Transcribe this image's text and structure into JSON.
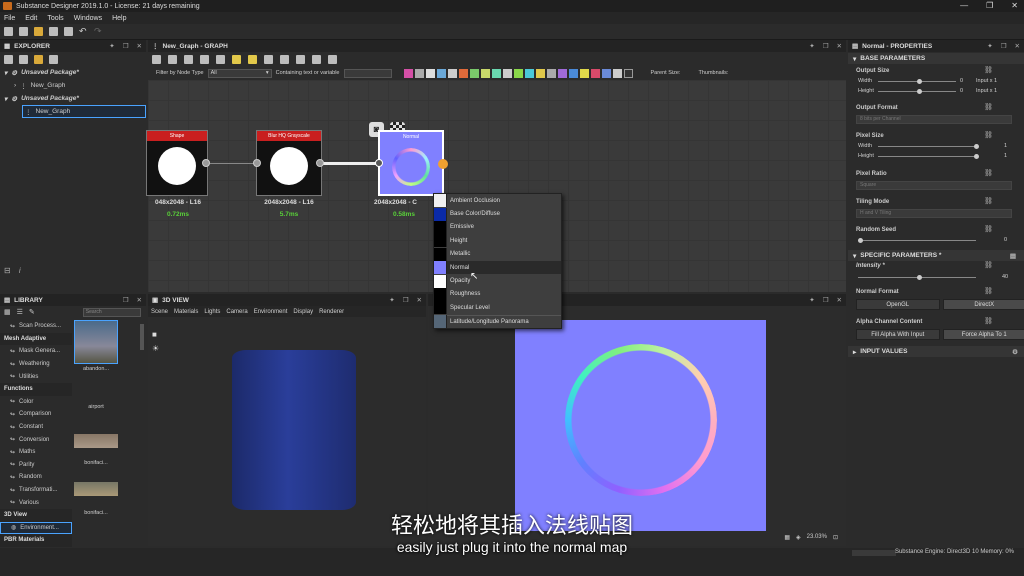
{
  "window": {
    "title": "Substance Designer 2019.1.0 - License: 21 days remaining",
    "minimize": "—",
    "maximize": "❐",
    "close": "✕"
  },
  "menu": [
    "File",
    "Edit",
    "Tools",
    "Windows",
    "Help"
  ],
  "explorer": {
    "title": "EXPLORER",
    "items": [
      {
        "label": "Unsaved Package*",
        "type": "package"
      },
      {
        "label": "New_Graph",
        "type": "graph"
      },
      {
        "label": "Unsaved Package*",
        "type": "package"
      },
      {
        "label": "New_Graph",
        "type": "graph",
        "selected": true
      }
    ]
  },
  "graph": {
    "title": "New_Graph - GRAPH",
    "filter_label": "Filter by Node Type",
    "filter_value": "All",
    "containing_label": "Containing text or variable",
    "parent_size_label": "Parent Size:",
    "thumbnails_label": "Thumbnails:",
    "nodes": [
      {
        "header": "Shape",
        "resolution": "048x2048 - L16",
        "time": "0.72ms"
      },
      {
        "header": "Blur HQ Grayscale",
        "resolution": "2048x2048 - L16",
        "time": "5.7ms"
      },
      {
        "header": "Normal",
        "resolution": "2048x2048 - C",
        "time": "0.58ms"
      }
    ],
    "dropdown": [
      {
        "label": "Ambient Occlusion",
        "color": "#f0f0f0"
      },
      {
        "label": "Base Color/Diffuse",
        "color": "#0a2aa8"
      },
      {
        "label": "Emissive",
        "color": "#000000"
      },
      {
        "label": "Height",
        "color": "#000000"
      },
      {
        "label": "Metallic",
        "color": "#000000"
      },
      {
        "label": "Normal",
        "color": "#8080ff",
        "hovered": true
      },
      {
        "label": "Opacity",
        "color": "#ffffff"
      },
      {
        "label": "Roughness",
        "color": "#000000"
      },
      {
        "label": "Specular Level",
        "color": "#000000"
      },
      {
        "label": "Latitude/Longitude Panorama",
        "color": "#556677"
      }
    ]
  },
  "library": {
    "title": "LIBRARY",
    "search_placeholder": "Search",
    "items": [
      {
        "label": "Scan Process...",
        "kind": "item"
      },
      {
        "label": "Mesh Adaptive",
        "kind": "cat"
      },
      {
        "label": "Mask Genera...",
        "kind": "item"
      },
      {
        "label": "Weathering",
        "kind": "item"
      },
      {
        "label": "Utilities",
        "kind": "item"
      },
      {
        "label": "Functions",
        "kind": "cat"
      },
      {
        "label": "Color",
        "kind": "item"
      },
      {
        "label": "Comparison",
        "kind": "item"
      },
      {
        "label": "Constant",
        "kind": "item"
      },
      {
        "label": "Conversion",
        "kind": "item"
      },
      {
        "label": "Maths",
        "kind": "item"
      },
      {
        "label": "Parity",
        "kind": "item"
      },
      {
        "label": "Random",
        "kind": "item"
      },
      {
        "label": "Transformati...",
        "kind": "item"
      },
      {
        "label": "Various",
        "kind": "item"
      },
      {
        "label": "3D View",
        "kind": "cat"
      },
      {
        "label": "Environment...",
        "kind": "selected"
      },
      {
        "label": "PBR Materials",
        "kind": "cat"
      }
    ],
    "thumbs": [
      "abandon...",
      "airport",
      "bonifaci...",
      "bonifaci..."
    ]
  },
  "view3d": {
    "title": "3D VIEW",
    "menu": [
      "Scene",
      "Materials",
      "Lights",
      "Camera",
      "Environment",
      "Display",
      "Renderer"
    ]
  },
  "view2d": {
    "zoom": "23.03%"
  },
  "properties": {
    "title": "Normal - PROPERTIES",
    "base_section": "BASE PARAMETERS",
    "output_size": "Output Size",
    "width": "Width",
    "height": "Height",
    "output_width_value": "0",
    "output_height_value": "0",
    "input_x1_w": "Input x 1",
    "input_x1_h": "Input x 1",
    "output_format": "Output Format",
    "output_format_value": "8 bits per Channel",
    "pixel_size": "Pixel Size",
    "pixel_width_value": "1",
    "pixel_height_value": "1",
    "pixel_ratio": "Pixel Ratio",
    "pixel_ratio_value": "Square",
    "tiling_mode": "Tiling Mode",
    "tiling_mode_value": "H and V Tiling",
    "random_seed": "Random Seed",
    "random_seed_value": "0",
    "specific_section": "SPECIFIC PARAMETERS *",
    "intensity": "Intensity *",
    "intensity_value": "40",
    "intensity_fraction": 0.5,
    "normal_format": "Normal Format",
    "opengl": "OpenGL",
    "directx": "DirectX",
    "alpha_content": "Alpha Channel Content",
    "fill_alpha": "Fill Alpha With Input",
    "force_alpha": "Force Alpha To 1",
    "input_section": "INPUT VALUES"
  },
  "status": {
    "engine": "Substance Engine: Direct3D 10  Memory: 0%"
  },
  "subtitles": {
    "cn": "轻松地将其插入法线贴图",
    "en": "easily just plug it into the normal map"
  }
}
